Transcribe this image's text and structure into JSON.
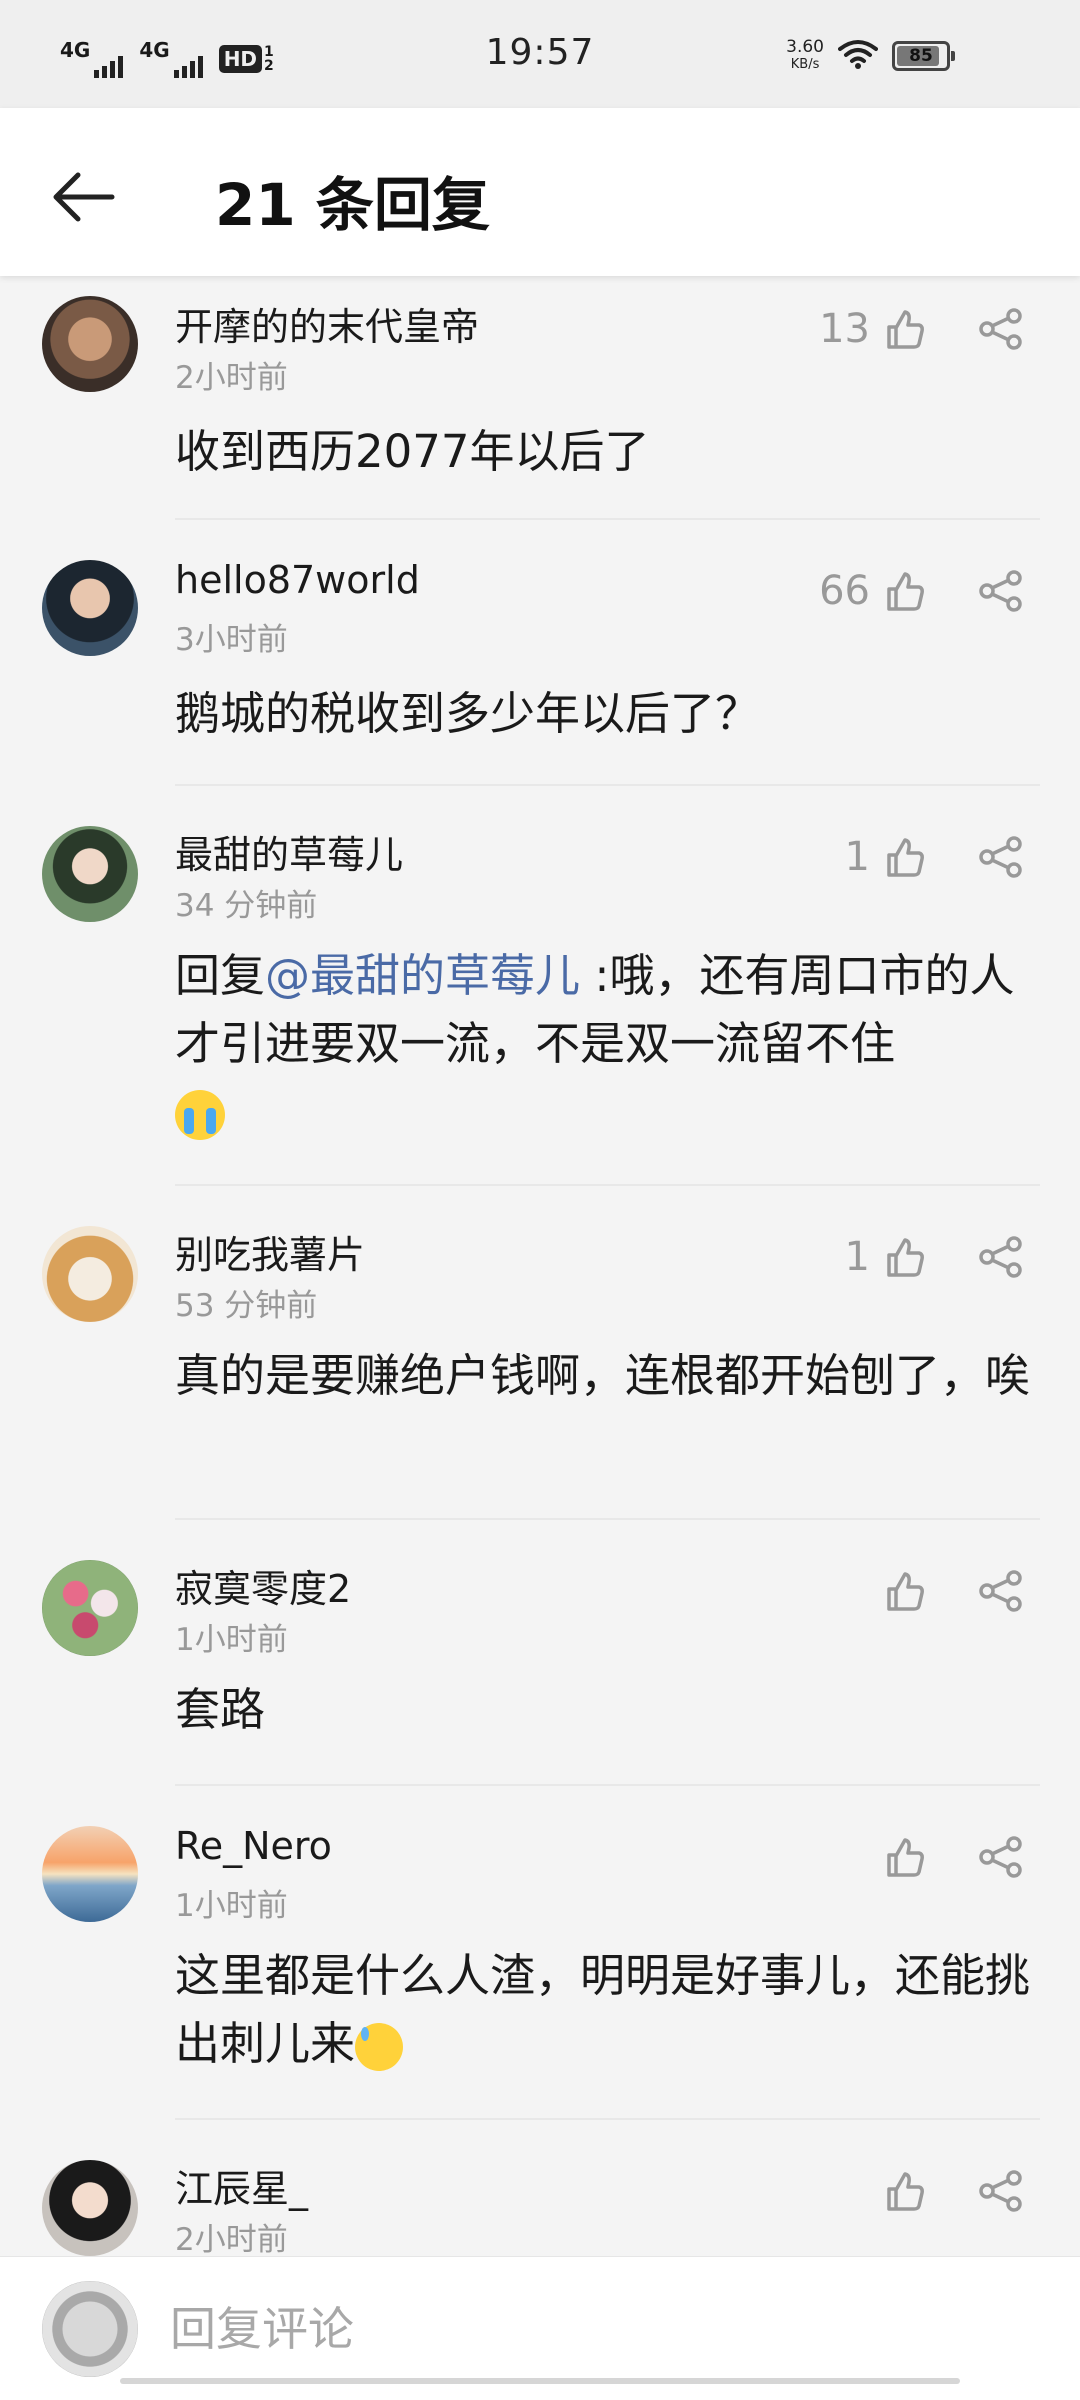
{
  "status_bar": {
    "network_1": "4G",
    "network_2": "4G",
    "hd_label": "HD",
    "hd_sub_1": "1",
    "hd_sub_2": "2",
    "time": "19:57",
    "speed_value": "3.60",
    "speed_unit": "KB/s",
    "battery_level": "85"
  },
  "header": {
    "title": "21 条回复"
  },
  "comments": [
    {
      "username": "开摩的的末代皇帝",
      "time": "2小时前",
      "likes": "13",
      "text": "收到西历2077年以后了"
    },
    {
      "username": "hello87world",
      "time": "3小时前",
      "likes": "66",
      "text": "鹅城的税收到多少年以后了？"
    },
    {
      "username": "最甜的草莓儿",
      "time": "34 分钟前",
      "likes": "1",
      "reply_prefix": "回复",
      "mention": "@最甜的草莓儿",
      "text": " :哦，还有周口市的人才引进要双一流，不是双一流留不住"
    },
    {
      "username": "别吃我薯片",
      "time": "53 分钟前",
      "likes": "1",
      "text": "真的是要赚绝户钱啊，连根都开始刨了，唉"
    },
    {
      "username": "寂寞零度2",
      "time": "1小时前",
      "likes": "",
      "text": "套路"
    },
    {
      "username": "Re_Nero",
      "time": "1小时前",
      "likes": "",
      "text": "这里都是什么人渣，明明是好事儿，还能挑出刺儿来"
    },
    {
      "username": "江辰星_",
      "time": "2小时前",
      "likes": "",
      "text": ""
    }
  ],
  "reply_bar": {
    "placeholder": "回复评论"
  },
  "colors": {
    "mention": "#4a6aa6",
    "secondary_text": "#999999",
    "background": "#f4f4f4"
  }
}
